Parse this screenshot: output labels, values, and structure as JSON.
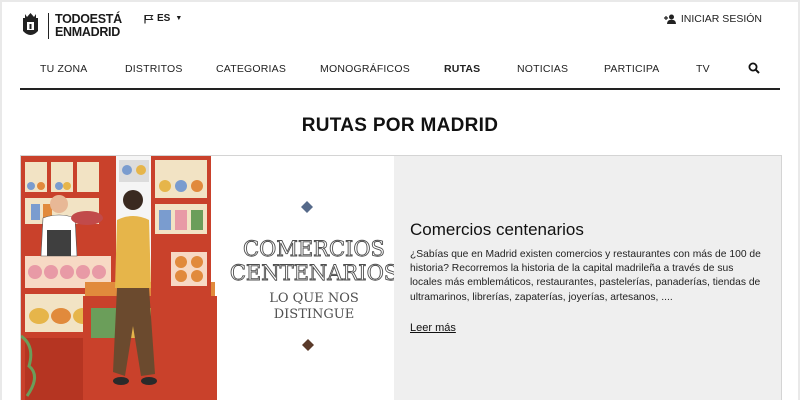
{
  "header": {
    "logo": {
      "line1": "TODOESTÁ",
      "line2": "ENMADRID"
    },
    "language": {
      "selected": "ES"
    },
    "login_label": "INICIAR SESIÓN"
  },
  "nav": {
    "items": [
      {
        "label": "TU ZONA"
      },
      {
        "label": "DISTRITOS"
      },
      {
        "label": "CATEGORIAS"
      },
      {
        "label": "MONOGRÁFICOS"
      },
      {
        "label": "RUTAS",
        "active": true
      },
      {
        "label": "NOTICIAS"
      },
      {
        "label": "PARTICIPA"
      },
      {
        "label": "TV"
      }
    ]
  },
  "page_title": "RUTAS POR MADRID",
  "card": {
    "image": {
      "headline_line1": "COMERCIOS",
      "headline_line2": "CENTENARIOS",
      "tagline_line1": "LO QUE NOS",
      "tagline_line2": "DISTINGUE"
    },
    "title": "Comercios centenarios",
    "description": "¿Sabías que en Madrid existen comercios y restaurantes  con más de 100 de historia? Recorremos la historia de la capital madrileña a través de sus locales más emblemáticos, restaurantes, pastelerías, panaderías, tiendas de ultramarinos, librerías, zapaterías, joyerías, artesanos, ....",
    "read_more": "Leer más"
  },
  "colors": {
    "accent": "#1a1a1a",
    "card_bg": "#efefef",
    "shop_red": "#c9412b",
    "shop_orange": "#e18a3c",
    "shirt_yellow": "#e6b54a"
  }
}
